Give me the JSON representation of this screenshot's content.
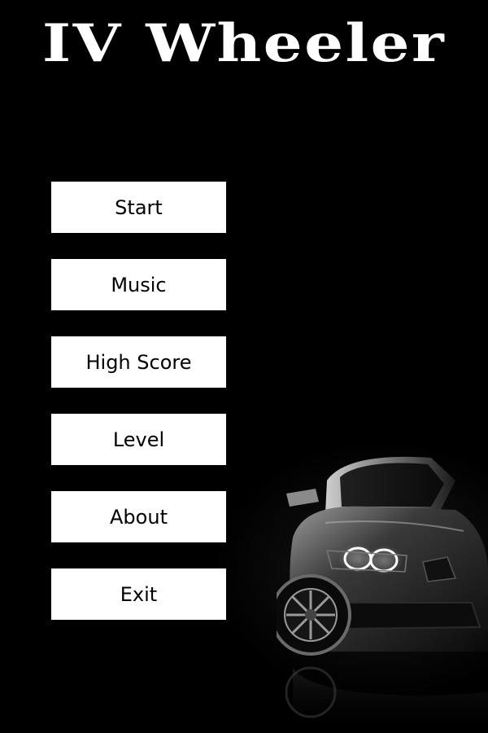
{
  "title": "IV Wheeler",
  "menu": {
    "start": "Start",
    "music": "Music",
    "high_score": "High Score",
    "level": "Level",
    "about": "About",
    "exit": "Exit"
  },
  "colors": {
    "background": "#000000",
    "button_bg": "#ffffff",
    "button_text": "#000000",
    "title": "#ffffff"
  }
}
